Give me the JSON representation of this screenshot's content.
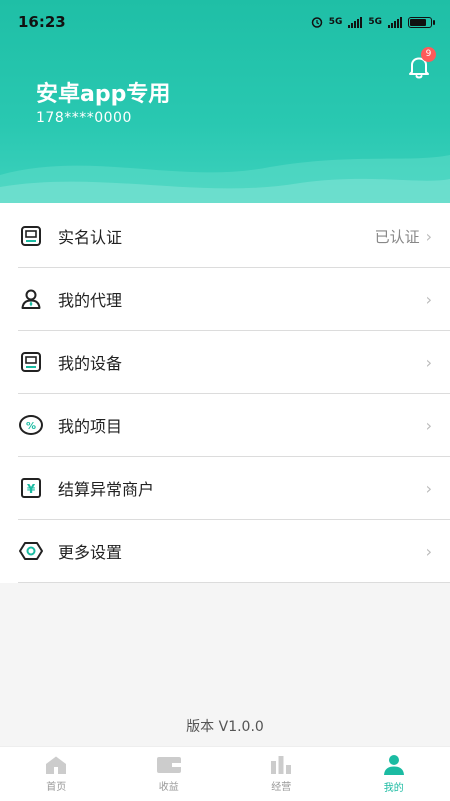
{
  "status_bar": {
    "time": "16:23",
    "network_1": "5G",
    "network_2": "5G",
    "battery_level": 0.8
  },
  "header": {
    "notification_count": "9",
    "user_name": "安卓app专用",
    "user_phone": "178****0000",
    "gradient_color": "#29c8b1"
  },
  "menu": {
    "items": [
      {
        "icon": "id-card-icon",
        "label": "实名认证",
        "value": "已认证"
      },
      {
        "icon": "agent-person-icon",
        "label": "我的代理",
        "value": ""
      },
      {
        "icon": "device-icon",
        "label": "我的设备",
        "value": ""
      },
      {
        "icon": "percent-icon",
        "label": "我的项目",
        "value": ""
      },
      {
        "icon": "yuan-icon",
        "label": "结算异常商户",
        "value": ""
      },
      {
        "icon": "settings-hexagon-icon",
        "label": "更多设置",
        "value": ""
      }
    ]
  },
  "version": "版本 V1.0.0",
  "tabbar": {
    "tabs": [
      {
        "icon": "home-icon",
        "label": "首页"
      },
      {
        "icon": "wallet-icon",
        "label": "收益"
      },
      {
        "icon": "bar-chart-icon",
        "label": "经营"
      },
      {
        "icon": "user-icon",
        "label": "我的"
      }
    ],
    "active_index": 3,
    "active_color": "#1bbba2",
    "inactive_color": "#cccccc"
  }
}
